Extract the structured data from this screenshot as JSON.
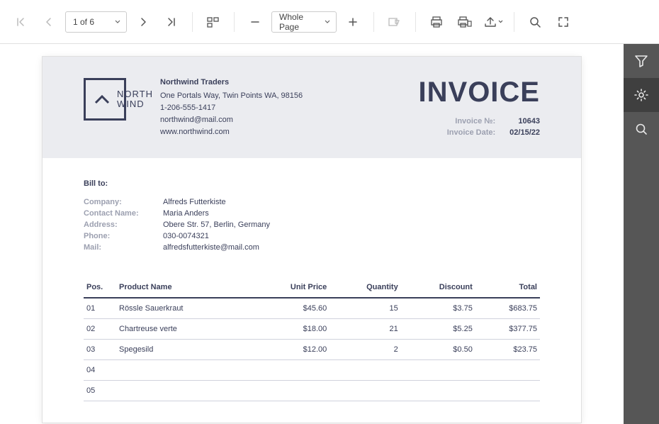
{
  "toolbar": {
    "page_label": "1 of 6",
    "zoom_label": "Whole Page"
  },
  "inv": {
    "company_name": "Northwind Traders",
    "address_line": "One Portals Way, Twin Points WA, 98156",
    "phone": "1-206-555-1417",
    "email": "northwind@mail.com",
    "website": "www.northwind.com",
    "logo_line1": "NORTH",
    "logo_line2": "WIND",
    "title": "INVOICE",
    "meta": {
      "number_lbl": "Invoice №:",
      "number_val": "10643",
      "date_lbl": "Invoice Date:",
      "date_val": "02/15/22"
    },
    "billto": {
      "title": "Bill to:",
      "company_lbl": "Company:",
      "company_val": "Alfreds Futterkiste",
      "contact_lbl": "Contact Name:",
      "contact_val": "Maria Anders",
      "address_lbl": "Address:",
      "address_val": "Obere Str. 57, Berlin, Germany",
      "phone_lbl": "Phone:",
      "phone_val": "030-0074321",
      "mail_lbl": "Mail:",
      "mail_val": "alfredsfutterkiste@mail.com"
    },
    "table": {
      "headers": {
        "pos": "Pos.",
        "product": "Product Name",
        "unit": "Unit Price",
        "qty": "Quantity",
        "discount": "Discount",
        "total": "Total"
      },
      "rows": [
        {
          "pos": "01",
          "product": "Rössle Sauerkraut",
          "unit": "$45.60",
          "qty": "15",
          "discount": "$3.75",
          "total": "$683.75"
        },
        {
          "pos": "02",
          "product": "Chartreuse verte",
          "unit": "$18.00",
          "qty": "21",
          "discount": "$5.25",
          "total": "$377.75"
        },
        {
          "pos": "03",
          "product": "Spegesild",
          "unit": "$12.00",
          "qty": "2",
          "discount": "$0.50",
          "total": "$23.75"
        },
        {
          "pos": "04",
          "product": "",
          "unit": "",
          "qty": "",
          "discount": "",
          "total": ""
        },
        {
          "pos": "05",
          "product": "",
          "unit": "",
          "qty": "",
          "discount": "",
          "total": ""
        }
      ]
    }
  }
}
